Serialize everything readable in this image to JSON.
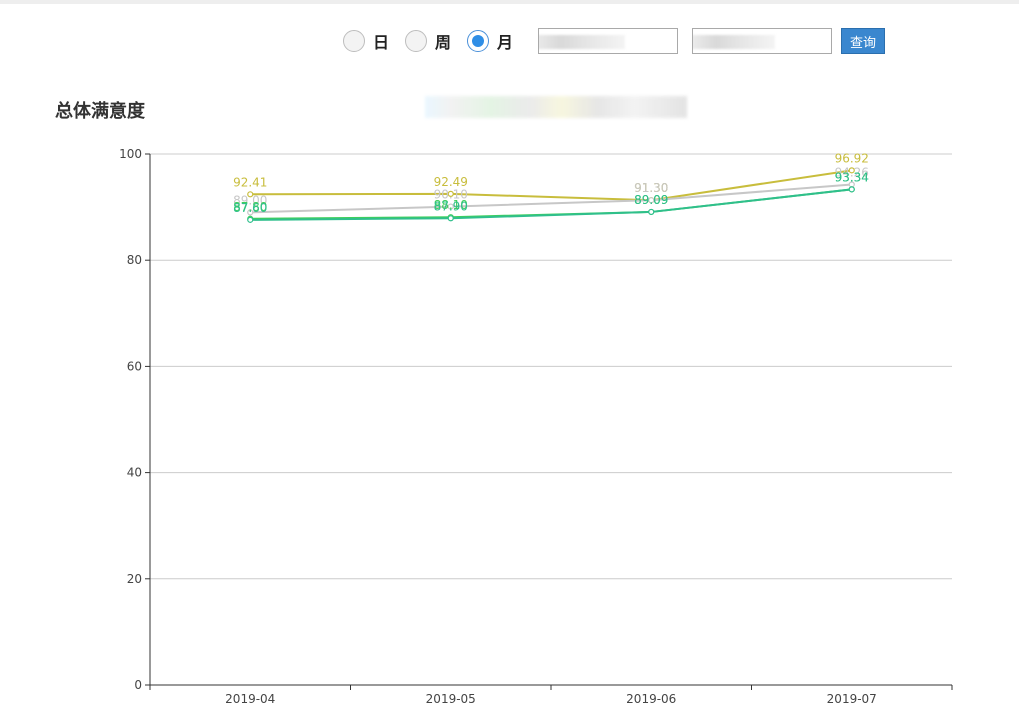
{
  "filters": {
    "period_options": [
      {
        "label": "日",
        "selected": false
      },
      {
        "label": "周",
        "selected": false
      },
      {
        "label": "月",
        "selected": true
      }
    ],
    "start_date": "",
    "end_date": "",
    "query_label": "查询"
  },
  "page_title": "总体满意度",
  "colors": {
    "accent": "#3a87cf"
  },
  "chart_data": {
    "type": "line",
    "title": "总体满意度",
    "xlabel": "",
    "ylabel": "",
    "categories": [
      "2019-04",
      "2019-05",
      "2019-06",
      "2019-07"
    ],
    "ylim": [
      0,
      100
    ],
    "yticks": [
      0,
      20,
      40,
      60,
      80,
      100
    ],
    "grid": true,
    "legend_placement": "top-center",
    "series": [
      {
        "color": "#c8bd3c",
        "values": [
          92.41,
          92.49,
          91.3,
          96.92
        ]
      },
      {
        "color": "#c7c7c7",
        "values": [
          89.0,
          90.1,
          91.3,
          94.26
        ]
      },
      {
        "color": "#3fcf5a",
        "values": [
          87.8,
          88.1,
          89.09,
          93.34
        ]
      },
      {
        "color": "#2fbf8c",
        "values": [
          87.6,
          87.9,
          89.09,
          93.34
        ]
      }
    ]
  }
}
